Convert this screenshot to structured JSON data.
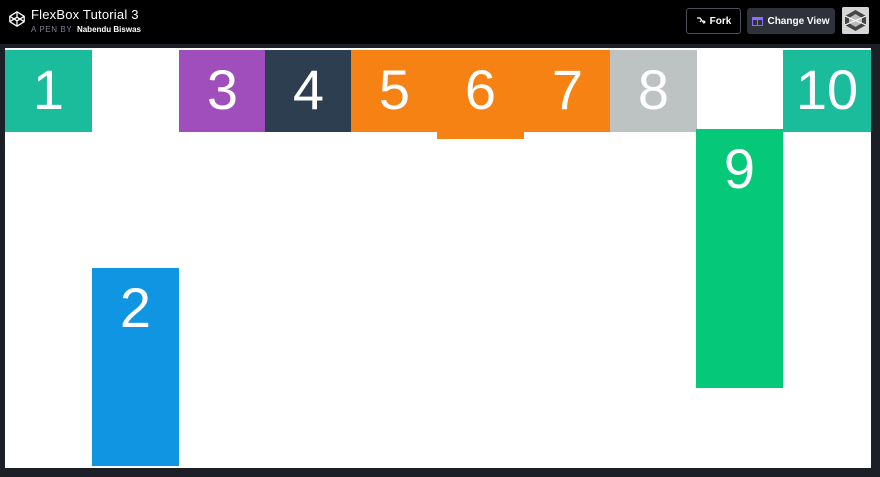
{
  "header": {
    "title": "FlexBox Tutorial 3",
    "byline_prefix": "A PEN BY",
    "author": "Nabendu Biswas",
    "fork_label": "Fork",
    "change_view_label": "Change View"
  },
  "boxes": [
    {
      "label": "1",
      "color": "#1abc9c"
    },
    {
      "label": "2",
      "color": "#0f95e2"
    },
    {
      "label": "3",
      "color": "#a04ebb"
    },
    {
      "label": "4",
      "color": "#2c3e50"
    },
    {
      "label": "5",
      "color": "#f58213"
    },
    {
      "label": "6",
      "color": "#f58213"
    },
    {
      "label": "7",
      "color": "#f58213"
    },
    {
      "label": "8",
      "color": "#bdc3c2"
    },
    {
      "label": "9",
      "color": "#05c878"
    },
    {
      "label": "10",
      "color": "#1abc9c"
    }
  ],
  "colors": {
    "header_bg": "#000000",
    "stage_bg": "#ffffff",
    "accent": "#1abc9c"
  },
  "icons": {
    "logo": "codepen-logo-icon",
    "fork": "fork-icon",
    "change_view": "layout-icon",
    "avatar": "user-avatar"
  }
}
